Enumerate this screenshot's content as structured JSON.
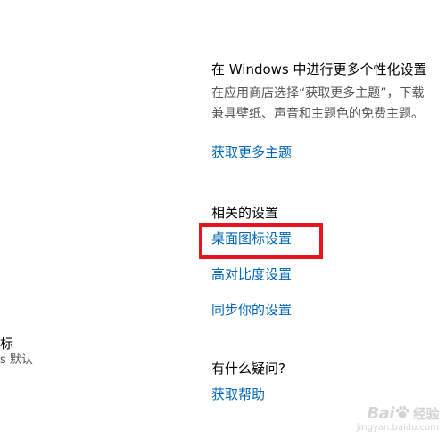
{
  "personalize": {
    "title": "在 Windows 中进行更多个性化设置",
    "description": "在应用商店选择“获取更多主题”，下载兼具壁纸、声音和主题色的免费主题。",
    "get_more_themes": "获取更多主题"
  },
  "related": {
    "title": "相关的设置",
    "desktop_icon_settings": "桌面图标设置",
    "high_contrast_settings": "高对比度设置",
    "sync_settings": "同步你的设置"
  },
  "help": {
    "title": "有什么疑问?",
    "get_help": "获取帮助"
  },
  "left_fragments": {
    "line1": "标",
    "line2": "s 默认"
  },
  "highlight": {
    "color": "#e6141f"
  },
  "watermark": {
    "text_prefix": "Bai",
    "text_suffix": "经验",
    "sub": "jingyan.baidu.com"
  },
  "colors": {
    "link": "#0067b8",
    "description": "#555555"
  }
}
